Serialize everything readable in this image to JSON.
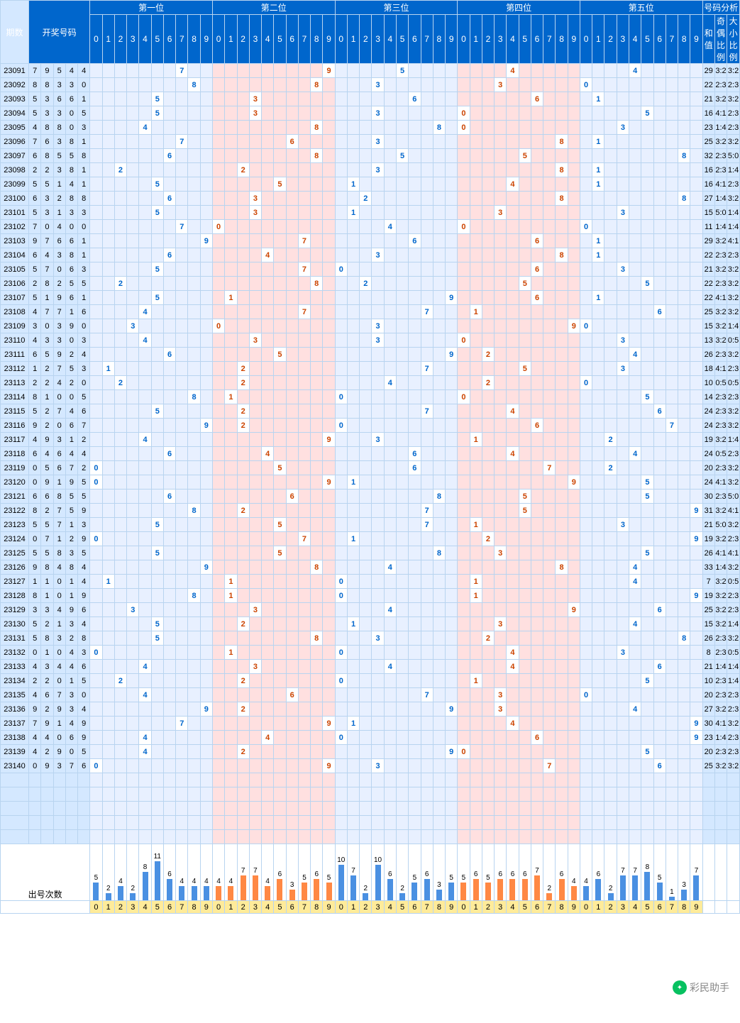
{
  "headers": {
    "period": "期数",
    "numbers": "开奖号码",
    "positions": [
      "第一位",
      "第二位",
      "第三位",
      "第四位",
      "第五位"
    ],
    "analysis": "号码分析",
    "sum": "和值",
    "oddeven": "奇偶比例",
    "bigsmall": "大小比例",
    "count_label": "出号次数"
  },
  "digit_labels": [
    "0",
    "1",
    "2",
    "3",
    "4",
    "5",
    "6",
    "7",
    "8",
    "9"
  ],
  "chart_data": {
    "type": "table",
    "title": "Lottery trend chart",
    "positions": 5,
    "rows": [
      {
        "period": "23091",
        "nums": [
          7,
          9,
          5,
          4,
          4
        ],
        "sum": 29,
        "oe": "3:2",
        "bs": "3:2"
      },
      {
        "period": "23092",
        "nums": [
          8,
          8,
          3,
          3,
          0
        ],
        "sum": 22,
        "oe": "2:3",
        "bs": "2:3"
      },
      {
        "period": "23093",
        "nums": [
          5,
          3,
          6,
          6,
          1
        ],
        "sum": 21,
        "oe": "3:2",
        "bs": "3:2"
      },
      {
        "period": "23094",
        "nums": [
          5,
          3,
          3,
          0,
          5
        ],
        "sum": 16,
        "oe": "4:1",
        "bs": "2:3"
      },
      {
        "period": "23095",
        "nums": [
          4,
          8,
          8,
          0,
          3
        ],
        "sum": 23,
        "oe": "1:4",
        "bs": "2:3"
      },
      {
        "period": "23096",
        "nums": [
          7,
          6,
          3,
          8,
          1
        ],
        "sum": 25,
        "oe": "3:2",
        "bs": "3:2"
      },
      {
        "period": "23097",
        "nums": [
          6,
          8,
          5,
          5,
          8
        ],
        "sum": 32,
        "oe": "2:3",
        "bs": "5:0"
      },
      {
        "period": "23098",
        "nums": [
          2,
          2,
          3,
          8,
          1
        ],
        "sum": 16,
        "oe": "2:3",
        "bs": "1:4"
      },
      {
        "period": "23099",
        "nums": [
          5,
          5,
          1,
          4,
          1
        ],
        "sum": 16,
        "oe": "4:1",
        "bs": "2:3"
      },
      {
        "period": "23100",
        "nums": [
          6,
          3,
          2,
          8,
          8
        ],
        "sum": 27,
        "oe": "1:4",
        "bs": "3:2"
      },
      {
        "period": "23101",
        "nums": [
          5,
          3,
          1,
          3,
          3
        ],
        "sum": 15,
        "oe": "5:0",
        "bs": "1:4"
      },
      {
        "period": "23102",
        "nums": [
          7,
          0,
          4,
          0,
          0
        ],
        "sum": 11,
        "oe": "1:4",
        "bs": "1:4"
      },
      {
        "period": "23103",
        "nums": [
          9,
          7,
          6,
          6,
          1
        ],
        "sum": 29,
        "oe": "3:2",
        "bs": "4:1"
      },
      {
        "period": "23104",
        "nums": [
          6,
          4,
          3,
          8,
          1
        ],
        "sum": 22,
        "oe": "2:3",
        "bs": "2:3"
      },
      {
        "period": "23105",
        "nums": [
          5,
          7,
          0,
          6,
          3
        ],
        "sum": 21,
        "oe": "3:2",
        "bs": "3:2"
      },
      {
        "period": "23106",
        "nums": [
          2,
          8,
          2,
          5,
          5
        ],
        "sum": 22,
        "oe": "2:3",
        "bs": "3:2"
      },
      {
        "period": "23107",
        "nums": [
          5,
          1,
          9,
          6,
          1
        ],
        "sum": 22,
        "oe": "4:1",
        "bs": "3:2"
      },
      {
        "period": "23108",
        "nums": [
          4,
          7,
          7,
          1,
          6
        ],
        "sum": 25,
        "oe": "3:2",
        "bs": "3:2"
      },
      {
        "period": "23109",
        "nums": [
          3,
          0,
          3,
          9,
          0
        ],
        "sum": 15,
        "oe": "3:2",
        "bs": "1:4"
      },
      {
        "period": "23110",
        "nums": [
          4,
          3,
          3,
          0,
          3
        ],
        "sum": 13,
        "oe": "3:2",
        "bs": "0:5"
      },
      {
        "period": "23111",
        "nums": [
          6,
          5,
          9,
          2,
          4
        ],
        "sum": 26,
        "oe": "2:3",
        "bs": "3:2"
      },
      {
        "period": "23112",
        "nums": [
          1,
          2,
          7,
          5,
          3
        ],
        "sum": 18,
        "oe": "4:1",
        "bs": "2:3"
      },
      {
        "period": "23113",
        "nums": [
          2,
          2,
          4,
          2,
          0
        ],
        "sum": 10,
        "oe": "0:5",
        "bs": "0:5"
      },
      {
        "period": "23114",
        "nums": [
          8,
          1,
          0,
          0,
          5
        ],
        "sum": 14,
        "oe": "2:3",
        "bs": "2:3"
      },
      {
        "period": "23115",
        "nums": [
          5,
          2,
          7,
          4,
          6
        ],
        "sum": 24,
        "oe": "2:3",
        "bs": "3:2"
      },
      {
        "period": "23116",
        "nums": [
          9,
          2,
          0,
          6,
          7
        ],
        "sum": 24,
        "oe": "2:3",
        "bs": "3:2"
      },
      {
        "period": "23117",
        "nums": [
          4,
          9,
          3,
          1,
          2
        ],
        "sum": 19,
        "oe": "3:2",
        "bs": "1:4"
      },
      {
        "period": "23118",
        "nums": [
          6,
          4,
          6,
          4,
          4
        ],
        "sum": 24,
        "oe": "0:5",
        "bs": "2:3"
      },
      {
        "period": "23119",
        "nums": [
          0,
          5,
          6,
          7,
          2
        ],
        "sum": 20,
        "oe": "2:3",
        "bs": "3:2"
      },
      {
        "period": "23120",
        "nums": [
          0,
          9,
          1,
          9,
          5
        ],
        "sum": 24,
        "oe": "4:1",
        "bs": "3:2"
      },
      {
        "period": "23121",
        "nums": [
          6,
          6,
          8,
          5,
          5
        ],
        "sum": 30,
        "oe": "2:3",
        "bs": "5:0"
      },
      {
        "period": "23122",
        "nums": [
          8,
          2,
          7,
          5,
          9
        ],
        "sum": 31,
        "oe": "3:2",
        "bs": "4:1"
      },
      {
        "period": "23123",
        "nums": [
          5,
          5,
          7,
          1,
          3
        ],
        "sum": 21,
        "oe": "5:0",
        "bs": "3:2"
      },
      {
        "period": "23124",
        "nums": [
          0,
          7,
          1,
          2,
          9
        ],
        "sum": 19,
        "oe": "3:2",
        "bs": "2:3"
      },
      {
        "period": "23125",
        "nums": [
          5,
          5,
          8,
          3,
          5
        ],
        "sum": 26,
        "oe": "4:1",
        "bs": "4:1"
      },
      {
        "period": "23126",
        "nums": [
          9,
          8,
          4,
          8,
          4
        ],
        "sum": 33,
        "oe": "1:4",
        "bs": "3:2"
      },
      {
        "period": "23127",
        "nums": [
          1,
          1,
          0,
          1,
          4
        ],
        "sum": 7,
        "oe": "3:2",
        "bs": "0:5"
      },
      {
        "period": "23128",
        "nums": [
          8,
          1,
          0,
          1,
          9
        ],
        "sum": 19,
        "oe": "3:2",
        "bs": "2:3"
      },
      {
        "period": "23129",
        "nums": [
          3,
          3,
          4,
          9,
          6
        ],
        "sum": 25,
        "oe": "3:2",
        "bs": "2:3"
      },
      {
        "period": "23130",
        "nums": [
          5,
          2,
          1,
          3,
          4
        ],
        "sum": 15,
        "oe": "3:2",
        "bs": "1:4"
      },
      {
        "period": "23131",
        "nums": [
          5,
          8,
          3,
          2,
          8
        ],
        "sum": 26,
        "oe": "2:3",
        "bs": "3:2"
      },
      {
        "period": "23132",
        "nums": [
          0,
          1,
          0,
          4,
          3
        ],
        "sum": 8,
        "oe": "2:3",
        "bs": "0:5"
      },
      {
        "period": "23133",
        "nums": [
          4,
          3,
          4,
          4,
          6
        ],
        "sum": 21,
        "oe": "1:4",
        "bs": "1:4"
      },
      {
        "period": "23134",
        "nums": [
          2,
          2,
          0,
          1,
          5
        ],
        "sum": 10,
        "oe": "2:3",
        "bs": "1:4"
      },
      {
        "period": "23135",
        "nums": [
          4,
          6,
          7,
          3,
          0
        ],
        "sum": 20,
        "oe": "2:3",
        "bs": "2:3"
      },
      {
        "period": "23136",
        "nums": [
          9,
          2,
          9,
          3,
          4
        ],
        "sum": 27,
        "oe": "3:2",
        "bs": "2:3"
      },
      {
        "period": "23137",
        "nums": [
          7,
          9,
          1,
          4,
          9
        ],
        "sum": 30,
        "oe": "4:1",
        "bs": "3:2"
      },
      {
        "period": "23138",
        "nums": [
          4,
          4,
          0,
          6,
          9
        ],
        "sum": 23,
        "oe": "1:4",
        "bs": "2:3"
      },
      {
        "period": "23139",
        "nums": [
          4,
          2,
          9,
          0,
          5
        ],
        "sum": 20,
        "oe": "2:3",
        "bs": "2:3"
      },
      {
        "period": "23140",
        "nums": [
          0,
          9,
          3,
          7,
          6
        ],
        "sum": 25,
        "oe": "3:2",
        "bs": "3:2"
      }
    ],
    "counts": [
      [
        5,
        2,
        4,
        2,
        8,
        11,
        6,
        4,
        4,
        4
      ],
      [
        4,
        4,
        7,
        7,
        4,
        6,
        3,
        5,
        6,
        5
      ],
      [
        10,
        7,
        2,
        10,
        6,
        2,
        5,
        6,
        3,
        5
      ],
      [
        5,
        6,
        5,
        6,
        6,
        6,
        7,
        2,
        6,
        4
      ],
      [
        4,
        6,
        2,
        7,
        7,
        8,
        5,
        1,
        3,
        7
      ]
    ]
  },
  "watermark": "彩民助手"
}
